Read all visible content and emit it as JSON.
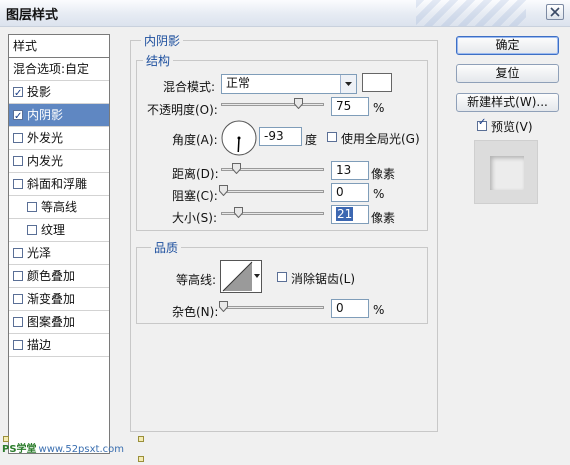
{
  "window": {
    "title": "图层样式"
  },
  "style_list": {
    "header": "样式",
    "items": [
      {
        "label": "混合选项:自定",
        "checkbox": false,
        "checked": false,
        "selected": false,
        "indent": false
      },
      {
        "label": "投影",
        "checkbox": true,
        "checked": true,
        "selected": false,
        "indent": false
      },
      {
        "label": "内阴影",
        "checkbox": true,
        "checked": true,
        "selected": true,
        "indent": false
      },
      {
        "label": "外发光",
        "checkbox": true,
        "checked": false,
        "selected": false,
        "indent": false
      },
      {
        "label": "内发光",
        "checkbox": true,
        "checked": false,
        "selected": false,
        "indent": false
      },
      {
        "label": "斜面和浮雕",
        "checkbox": true,
        "checked": false,
        "selected": false,
        "indent": false
      },
      {
        "label": "等高线",
        "checkbox": true,
        "checked": false,
        "selected": false,
        "indent": true
      },
      {
        "label": "纹理",
        "checkbox": true,
        "checked": false,
        "selected": false,
        "indent": true
      },
      {
        "label": "光泽",
        "checkbox": true,
        "checked": false,
        "selected": false,
        "indent": false
      },
      {
        "label": "颜色叠加",
        "checkbox": true,
        "checked": false,
        "selected": false,
        "indent": false
      },
      {
        "label": "渐变叠加",
        "checkbox": true,
        "checked": false,
        "selected": false,
        "indent": false
      },
      {
        "label": "图案叠加",
        "checkbox": true,
        "checked": false,
        "selected": false,
        "indent": false
      },
      {
        "label": "描边",
        "checkbox": true,
        "checked": false,
        "selected": false,
        "indent": false
      }
    ]
  },
  "panel": {
    "section_title": "内阴影",
    "structure": {
      "title": "结构",
      "blend_mode_label": "混合模式:",
      "blend_mode_value": "正常",
      "shadow_color": "#ffffff",
      "opacity_label": "不透明度(O):",
      "opacity_value": "75",
      "opacity_unit": "%",
      "opacity_level": 0.75,
      "angle_label": "角度(A):",
      "angle_value": "-93",
      "angle_unit": "度",
      "global_light_label": "使用全局光(G)",
      "global_light_checked": false,
      "distance_label": "距离(D):",
      "distance_value": "13",
      "distance_unit": "像素",
      "choke_label": "阻塞(C):",
      "choke_value": "0",
      "choke_unit": "%",
      "size_label": "大小(S):",
      "size_value": "21",
      "size_unit": "像素"
    },
    "quality": {
      "title": "品质",
      "contour_label": "等高线:",
      "anti_alias_label": "消除锯齿(L)",
      "anti_alias_checked": false,
      "noise_label": "杂色(N):",
      "noise_value": "0",
      "noise_unit": "%"
    }
  },
  "buttons": {
    "ok": "确定",
    "reset": "复位",
    "new_style": "新建样式(W)...",
    "preview_label": "预览(V)",
    "preview_checked": true
  },
  "watermark": {
    "brand": "PS学堂",
    "site": "www.52psxt.com"
  }
}
